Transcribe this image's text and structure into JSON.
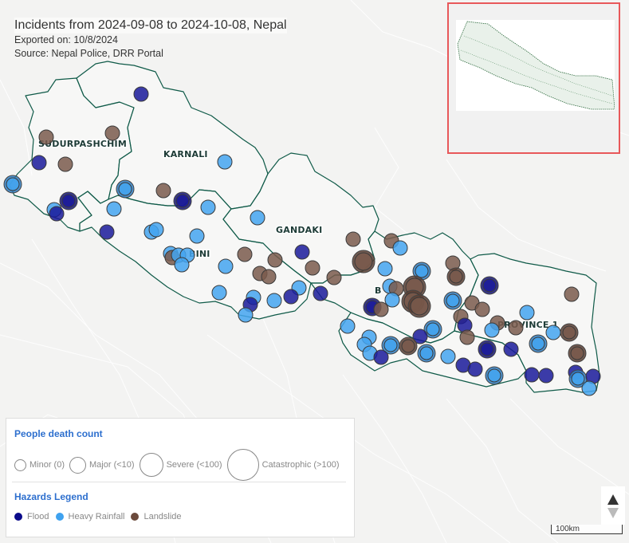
{
  "header": {
    "title": "Incidents from 2024-09-08 to 2024-10-08, Nepal",
    "exported": "Exported on: 10/8/2024",
    "source": "Source: Nepal Police, DRR Portal"
  },
  "regions": [
    {
      "name": "SUDURPASHCHIM"
    },
    {
      "name": "KARNALI"
    },
    {
      "name": "GANDAKI"
    },
    {
      "name": "BINI"
    },
    {
      "name": "B"
    },
    {
      "name": "PROVINCE 1"
    }
  ],
  "legend": {
    "death_title": "People death count",
    "death_levels": [
      {
        "label": "Minor (0)",
        "icon": "circle-small"
      },
      {
        "label": "Major (<10)",
        "icon": "circle-medium"
      },
      {
        "label": "Severe (<100)",
        "icon": "circle-large"
      },
      {
        "label": "Catastrophic (>100)",
        "icon": "circle-xlarge"
      }
    ],
    "hazard_title": "Hazards Legend",
    "hazards": [
      {
        "label": "Flood",
        "color": "#0a0a8a"
      },
      {
        "label": "Heavy Rainfall",
        "color": "#3fa2ef"
      },
      {
        "label": "Landslide",
        "color": "#6b4a3c"
      }
    ]
  },
  "colors": {
    "flood": "#1a1a9a",
    "rain": "#44a4f0",
    "landslide": "#7a5a4c",
    "border": "#0f5a48",
    "minimap_border": "#e8585a"
  },
  "scale": {
    "label": "100km"
  },
  "incidents": [
    {
      "hazard": "flood",
      "severity": "minor",
      "lon": 177,
      "lat": 118
    },
    {
      "hazard": "landslide",
      "severity": "minor",
      "lon": 58,
      "lat": 172
    },
    {
      "hazard": "landslide",
      "severity": "minor",
      "lon": 141,
      "lat": 167
    },
    {
      "hazard": "flood",
      "severity": "minor",
      "lon": 49,
      "lat": 204
    },
    {
      "hazard": "landslide",
      "severity": "minor",
      "lon": 82,
      "lat": 206
    },
    {
      "hazard": "rain",
      "severity": "minor",
      "lon": 282,
      "lat": 203
    },
    {
      "hazard": "rain",
      "severity": "major",
      "lon": 16,
      "lat": 231
    },
    {
      "hazard": "rain",
      "severity": "major",
      "lon": 157,
      "lat": 237
    },
    {
      "hazard": "landslide",
      "severity": "minor",
      "lon": 205,
      "lat": 239
    },
    {
      "hazard": "flood",
      "severity": "major",
      "lon": 229,
      "lat": 252
    },
    {
      "hazard": "flood",
      "severity": "major",
      "lon": 86,
      "lat": 252
    },
    {
      "hazard": "rain",
      "severity": "minor",
      "lon": 68,
      "lat": 263
    },
    {
      "hazard": "flood",
      "severity": "minor",
      "lon": 71,
      "lat": 268
    },
    {
      "hazard": "rain",
      "severity": "minor",
      "lon": 143,
      "lat": 262
    },
    {
      "hazard": "rain",
      "severity": "minor",
      "lon": 261,
      "lat": 260
    },
    {
      "hazard": "rain",
      "severity": "minor",
      "lon": 323,
      "lat": 273
    },
    {
      "hazard": "flood",
      "severity": "minor",
      "lon": 134,
      "lat": 291
    },
    {
      "hazard": "rain",
      "severity": "minor",
      "lon": 190,
      "lat": 291
    },
    {
      "hazard": "rain",
      "severity": "minor",
      "lon": 196,
      "lat": 288
    },
    {
      "hazard": "rain",
      "severity": "minor",
      "lon": 247,
      "lat": 296
    },
    {
      "hazard": "rain",
      "severity": "minor",
      "lon": 214,
      "lat": 318
    },
    {
      "hazard": "landslide",
      "severity": "minor",
      "lon": 216,
      "lat": 323
    },
    {
      "hazard": "rain",
      "severity": "minor",
      "lon": 224,
      "lat": 320
    },
    {
      "hazard": "rain",
      "severity": "minor",
      "lon": 235,
      "lat": 320
    },
    {
      "hazard": "rain",
      "severity": "minor",
      "lon": 228,
      "lat": 332
    },
    {
      "hazard": "landslide",
      "severity": "minor",
      "lon": 307,
      "lat": 319
    },
    {
      "hazard": "rain",
      "severity": "minor",
      "lon": 283,
      "lat": 334
    },
    {
      "hazard": "landslide",
      "severity": "minor",
      "lon": 345,
      "lat": 326
    },
    {
      "hazard": "flood",
      "severity": "minor",
      "lon": 379,
      "lat": 316
    },
    {
      "hazard": "landslide",
      "severity": "minor",
      "lon": 392,
      "lat": 336
    },
    {
      "hazard": "landslide",
      "severity": "minor",
      "lon": 326,
      "lat": 343
    },
    {
      "hazard": "landslide",
      "severity": "minor",
      "lon": 337,
      "lat": 347
    },
    {
      "hazard": "landslide",
      "severity": "minor",
      "lon": 419,
      "lat": 348
    },
    {
      "hazard": "flood",
      "severity": "minor",
      "lon": 402,
      "lat": 368
    },
    {
      "hazard": "rain",
      "severity": "minor",
      "lon": 375,
      "lat": 361
    },
    {
      "hazard": "rain",
      "severity": "minor",
      "lon": 275,
      "lat": 367
    },
    {
      "hazard": "rain",
      "severity": "minor",
      "lon": 318,
      "lat": 373
    },
    {
      "hazard": "flood",
      "severity": "minor",
      "lon": 314,
      "lat": 382
    },
    {
      "hazard": "rain",
      "severity": "minor",
      "lon": 344,
      "lat": 377
    },
    {
      "hazard": "flood",
      "severity": "minor",
      "lon": 365,
      "lat": 372
    },
    {
      "hazard": "rain",
      "severity": "minor",
      "lon": 308,
      "lat": 395
    },
    {
      "hazard": "landslide",
      "severity": "minor",
      "lon": 443,
      "lat": 300
    },
    {
      "hazard": "landslide",
      "severity": "minor",
      "lon": 491,
      "lat": 302
    },
    {
      "hazard": "rain",
      "severity": "minor",
      "lon": 502,
      "lat": 311
    },
    {
      "hazard": "landslide",
      "severity": "severe",
      "lon": 456,
      "lat": 328
    },
    {
      "hazard": "rain",
      "severity": "minor",
      "lon": 483,
      "lat": 337
    },
    {
      "hazard": "rain",
      "severity": "major",
      "lon": 529,
      "lat": 340
    },
    {
      "hazard": "rain",
      "severity": "minor",
      "lon": 489,
      "lat": 359
    },
    {
      "hazard": "landslide",
      "severity": "minor",
      "lon": 497,
      "lat": 362
    },
    {
      "hazard": "landslide",
      "severity": "severe",
      "lon": 520,
      "lat": 360
    },
    {
      "hazard": "rain",
      "severity": "minor",
      "lon": 492,
      "lat": 376
    },
    {
      "hazard": "landslide",
      "severity": "severe",
      "lon": 518,
      "lat": 378
    },
    {
      "hazard": "landslide",
      "severity": "severe",
      "lon": 526,
      "lat": 384
    },
    {
      "hazard": "flood",
      "severity": "major",
      "lon": 467,
      "lat": 385
    },
    {
      "hazard": "landslide",
      "severity": "minor",
      "lon": 478,
      "lat": 388
    },
    {
      "hazard": "landslide",
      "severity": "minor",
      "lon": 568,
      "lat": 330
    },
    {
      "hazard": "landslide",
      "severity": "major",
      "lon": 572,
      "lat": 347
    },
    {
      "hazard": "flood",
      "severity": "major",
      "lon": 614,
      "lat": 358
    },
    {
      "hazard": "rain",
      "severity": "major",
      "lon": 568,
      "lat": 377
    },
    {
      "hazard": "landslide",
      "severity": "minor",
      "lon": 717,
      "lat": 369
    },
    {
      "hazard": "landslide",
      "severity": "minor",
      "lon": 592,
      "lat": 380
    },
    {
      "hazard": "landslide",
      "severity": "minor",
      "lon": 605,
      "lat": 388
    },
    {
      "hazard": "rain",
      "severity": "minor",
      "lon": 661,
      "lat": 392
    },
    {
      "hazard": "landslide",
      "severity": "minor",
      "lon": 578,
      "lat": 397
    },
    {
      "hazard": "flood",
      "severity": "minor",
      "lon": 583,
      "lat": 408
    },
    {
      "hazard": "landslide",
      "severity": "minor",
      "lon": 586,
      "lat": 423
    },
    {
      "hazard": "landslide",
      "severity": "minor",
      "lon": 624,
      "lat": 405
    },
    {
      "hazard": "rain",
      "severity": "minor",
      "lon": 617,
      "lat": 414
    },
    {
      "hazard": "landslide",
      "severity": "minor",
      "lon": 647,
      "lat": 411
    },
    {
      "hazard": "rain",
      "severity": "minor",
      "lon": 694,
      "lat": 417
    },
    {
      "hazard": "landslide",
      "severity": "major",
      "lon": 714,
      "lat": 417
    },
    {
      "hazard": "rain",
      "severity": "minor",
      "lon": 436,
      "lat": 409
    },
    {
      "hazard": "rain",
      "severity": "major",
      "lon": 543,
      "lat": 413
    },
    {
      "hazard": "flood",
      "severity": "minor",
      "lon": 527,
      "lat": 422
    },
    {
      "hazard": "rain",
      "severity": "minor",
      "lon": 463,
      "lat": 423
    },
    {
      "hazard": "rain",
      "severity": "minor",
      "lon": 457,
      "lat": 432
    },
    {
      "hazard": "rain",
      "severity": "major",
      "lon": 490,
      "lat": 433
    },
    {
      "hazard": "landslide",
      "severity": "major",
      "lon": 512,
      "lat": 434
    },
    {
      "hazard": "rain",
      "severity": "major",
      "lon": 535,
      "lat": 443
    },
    {
      "hazard": "rain",
      "severity": "minor",
      "lon": 562,
      "lat": 447
    },
    {
      "hazard": "rain",
      "severity": "major",
      "lon": 675,
      "lat": 431
    },
    {
      "hazard": "flood",
      "severity": "major",
      "lon": 611,
      "lat": 438
    },
    {
      "hazard": "flood",
      "severity": "minor",
      "lon": 641,
      "lat": 438
    },
    {
      "hazard": "rain",
      "severity": "minor",
      "lon": 464,
      "lat": 443
    },
    {
      "hazard": "flood",
      "severity": "minor",
      "lon": 478,
      "lat": 448
    },
    {
      "hazard": "landslide",
      "severity": "major",
      "lon": 724,
      "lat": 443
    },
    {
      "hazard": "flood",
      "severity": "minor",
      "lon": 581,
      "lat": 458
    },
    {
      "hazard": "flood",
      "severity": "minor",
      "lon": 596,
      "lat": 463
    },
    {
      "hazard": "rain",
      "severity": "major",
      "lon": 620,
      "lat": 471
    },
    {
      "hazard": "flood",
      "severity": "minor",
      "lon": 667,
      "lat": 470
    },
    {
      "hazard": "flood",
      "severity": "minor",
      "lon": 685,
      "lat": 471
    },
    {
      "hazard": "flood",
      "severity": "minor",
      "lon": 722,
      "lat": 467
    },
    {
      "hazard": "rain",
      "severity": "major",
      "lon": 725,
      "lat": 475
    },
    {
      "hazard": "flood",
      "severity": "minor",
      "lon": 744,
      "lat": 472
    },
    {
      "hazard": "rain",
      "severity": "minor",
      "lon": 739,
      "lat": 487
    }
  ]
}
